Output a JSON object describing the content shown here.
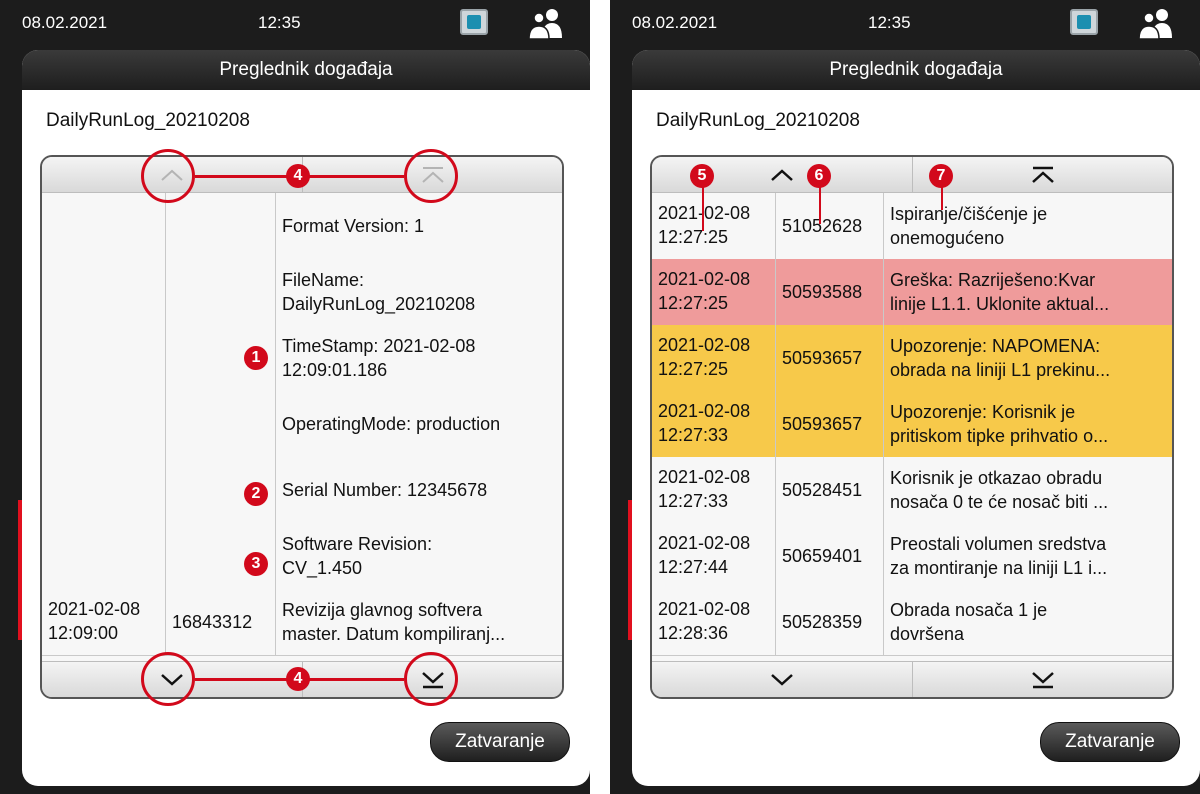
{
  "status": {
    "date": "08.02.2021",
    "time": "12:35"
  },
  "dialog": {
    "title": "Preglednik događaja",
    "file": "DailyRunLog_20210208",
    "close_label": "Zatvaranje"
  },
  "left_rows": [
    {
      "date": "",
      "time": "",
      "id": "",
      "l1": "Format Version: 1",
      "l2": ""
    },
    {
      "date": "",
      "time": "",
      "id": "",
      "l1": "FileName:",
      "l2": "DailyRunLog_20210208"
    },
    {
      "date": "",
      "time": "",
      "id": "",
      "l1": "TimeStamp: 2021-02-08",
      "l2": "12:09:01.186"
    },
    {
      "date": "",
      "time": "",
      "id": "",
      "l1": "OperatingMode: production",
      "l2": ""
    },
    {
      "date": "",
      "time": "",
      "id": "",
      "l1": "Serial Number: 12345678",
      "l2": ""
    },
    {
      "date": "",
      "time": "",
      "id": "",
      "l1": "Software Revision:",
      "l2": "CV_1.450"
    },
    {
      "date": "2021-02-08",
      "time": "12:09:00",
      "id": "16843312",
      "l1": "Revizija glavnog softvera",
      "l2": "master. Datum kompiliranj..."
    }
  ],
  "right_rows": [
    {
      "date": "2021-02-08",
      "time": "12:27:25",
      "id": "51052628",
      "l1": "Ispiranje/čišćenje je",
      "l2": "onemogućeno",
      "type": "normal"
    },
    {
      "date": "2021-02-08",
      "time": "12:27:25",
      "id": "50593588",
      "l1": "Greška: Razriješeno:Kvar",
      "l2": "linije L1.1. Uklonite aktual...",
      "type": "error"
    },
    {
      "date": "2021-02-08",
      "time": "12:27:25",
      "id": "50593657",
      "l1": "Upozorenje: NAPOMENA:",
      "l2": "obrada na liniji L1 prekinu...",
      "type": "warn"
    },
    {
      "date": "2021-02-08",
      "time": "12:27:33",
      "id": "50593657",
      "l1": "Upozorenje: Korisnik je",
      "l2": "pritiskom tipke prihvatio o...",
      "type": "warn"
    },
    {
      "date": "2021-02-08",
      "time": "12:27:33",
      "id": "50528451",
      "l1": "Korisnik je otkazao obradu",
      "l2": "nosača 0 te će nosač biti ...",
      "type": "normal"
    },
    {
      "date": "2021-02-08",
      "time": "12:27:44",
      "id": "50659401",
      "l1": "Preostali volumen sredstva",
      "l2": "za montiranje na liniji L1 i...",
      "type": "normal"
    },
    {
      "date": "2021-02-08",
      "time": "12:28:36",
      "id": "50528359",
      "l1": "Obrada nosača 1 je",
      "l2": "dovršena",
      "type": "normal"
    }
  ],
  "callouts": {
    "c1": "1",
    "c2": "2",
    "c3": "3",
    "c4": "4",
    "c5": "5",
    "c6": "6",
    "c7": "7"
  },
  "colors": {
    "error": "#ef9b9b",
    "warning": "#f7c94a",
    "callout": "#d2091b"
  },
  "icons": {
    "monitor": "monitor-icon",
    "users": "users-icon",
    "up": "chevron-up-icon",
    "top": "scroll-top-icon",
    "down": "chevron-down-icon",
    "bottom": "scroll-bottom-icon"
  }
}
